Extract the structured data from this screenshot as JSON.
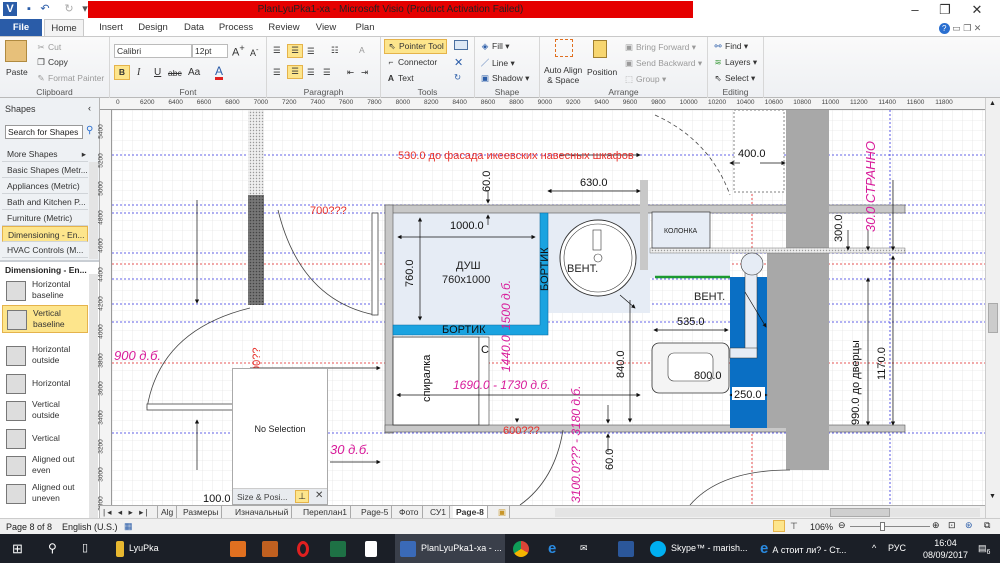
{
  "window": {
    "title": "PlanLyuPka1-xa  -  Microsoft Visio (Product Activation Failed)",
    "title_bar_color": "#e50000"
  },
  "menu_tabs": [
    "File",
    "Home",
    "Insert",
    "Design",
    "Data",
    "Process",
    "Review",
    "View",
    "Plan"
  ],
  "ribbon": {
    "clipboard": {
      "label": "Clipboard",
      "paste": "Paste",
      "cut": "Cut",
      "copy": "Copy",
      "format_painter": "Format Painter"
    },
    "font": {
      "label": "Font",
      "font_name": "Calibri",
      "font_size": "12pt",
      "bold": "B",
      "italic": "I",
      "underline": "U",
      "strike": "abc",
      "case": "Aa",
      "color": "A"
    },
    "paragraph": {
      "label": "Paragraph"
    },
    "tools": {
      "label": "Tools",
      "pointer": "Pointer Tool",
      "connector": "Connector",
      "text": "Text"
    },
    "shape": {
      "label": "Shape",
      "fill": "Fill",
      "line": "Line",
      "shadow": "Shadow"
    },
    "arrange": {
      "label": "Arrange",
      "auto_align": "Auto Align",
      "auto_align2": "& Space",
      "position": "Position",
      "bring_forward": "Bring Forward",
      "send_backward": "Send Backward",
      "group": "Group"
    },
    "editing": {
      "label": "Editing",
      "find": "Find",
      "layers": "Layers",
      "select": "Select"
    }
  },
  "shapes_panel": {
    "title": "Shapes",
    "search_placeholder": "Search for Shapes",
    "more_shapes": "More Shapes",
    "stencils": [
      "Basic Shapes (Metr...",
      "Appliances (Metric)",
      "Bath and Kitchen P...",
      "Furniture (Metric)",
      "Dimensioning - En...",
      "HVAC Controls (M..."
    ],
    "active_stencil": "Dimensioning - En...",
    "stencil_header": "Dimensioning - En...",
    "items": [
      {
        "label1": "Horizontal",
        "label2": "baseline"
      },
      {
        "label1": "Vertical",
        "label2": "baseline"
      },
      {
        "label1": "Horizontal",
        "label2": "outside"
      },
      {
        "label1": "Horizontal",
        "label2": ""
      },
      {
        "label1": "Vertical",
        "label2": "outside"
      },
      {
        "label1": "Vertical",
        "label2": ""
      },
      {
        "label1": "Aligned out",
        "label2": "even"
      },
      {
        "label1": "Aligned out",
        "label2": "uneven"
      }
    ]
  },
  "ruler": {
    "top": [
      "0",
      "6200",
      "6400",
      "6600",
      "6800",
      "7000",
      "7200",
      "7400",
      "7600",
      "7800",
      "8000",
      "8200",
      "8400",
      "8600",
      "8800",
      "9000",
      "9200",
      "9400",
      "9600",
      "9800",
      "10000",
      "10200",
      "10400",
      "10600",
      "10800",
      "11000",
      "11200",
      "11400",
      "11600",
      "11800"
    ],
    "left": [
      "5400",
      "5200",
      "5000",
      "4800",
      "4600",
      "4400",
      "4200",
      "4000",
      "3800",
      "3600",
      "3400",
      "3200",
      "3000",
      "2800"
    ]
  },
  "drawing": {
    "colors": {
      "red": "#e8302a",
      "magenta": "#d81b9a",
      "wall": "#c8c8c8",
      "bortik": "#1aa3e0",
      "vent_box": "#0a6fc4",
      "room_fill": "#e6ecf5"
    },
    "labels": {
      "facade": "530.0 до фасада икеевских навесных шкафов",
      "d400": "400.0",
      "strange": "30.0 СТРАННО",
      "d60_top": "60.0",
      "d630": "630.0",
      "d700": "700???",
      "d1000": "1000.0",
      "kolonka": "КОЛОНКА",
      "d300": "300.0",
      "d760": "760.0",
      "dush": "ДУШ",
      "dush_size": "760x1000",
      "bortik_v": "БОРТИК",
      "d1500": "1500 д.б.",
      "vent1": "ВЕНТ.",
      "vent2": "ВЕНТ.",
      "bortik_h": "БОРТИК",
      "d535": "535.0",
      "d1170": "1170.0",
      "d990": "990.0 до дверцы",
      "d900": "900 д.б.",
      "d00": "00??",
      "d1440": "1440.0",
      "c": "С",
      "spiralka": "спиралка",
      "d840": "840.0",
      "d800": "800.0",
      "d1690": "1690.0 - 1730 д.б.",
      "d250": "250.0",
      "d600": "600???",
      "d3100": "3100.0??? - 3180 д.б.",
      "d30": "30 д.б.",
      "d60_bottom": "60.0",
      "d100": "100.0"
    }
  },
  "size_position": {
    "empty": "No Selection",
    "title": "Size & Posi..."
  },
  "page_tabs": [
    "Alg",
    "Размеры",
    "Изначальный",
    "Переплан1",
    "Page-5",
    "Фото",
    "СУ1",
    "Page-8"
  ],
  "active_page": "Page-8",
  "status": {
    "page": "Page 8 of 8",
    "language": "English (U.S.)",
    "zoom": "106%"
  },
  "taskbar": {
    "items": [
      "LyuPka",
      "PlanLyuPka1-xa - ...",
      "Skype™ - marish...",
      "А стоит ли? - Ст..."
    ],
    "lang": "РУС",
    "time": "16:04",
    "date": "08/09/2017",
    "notifications": "6"
  }
}
